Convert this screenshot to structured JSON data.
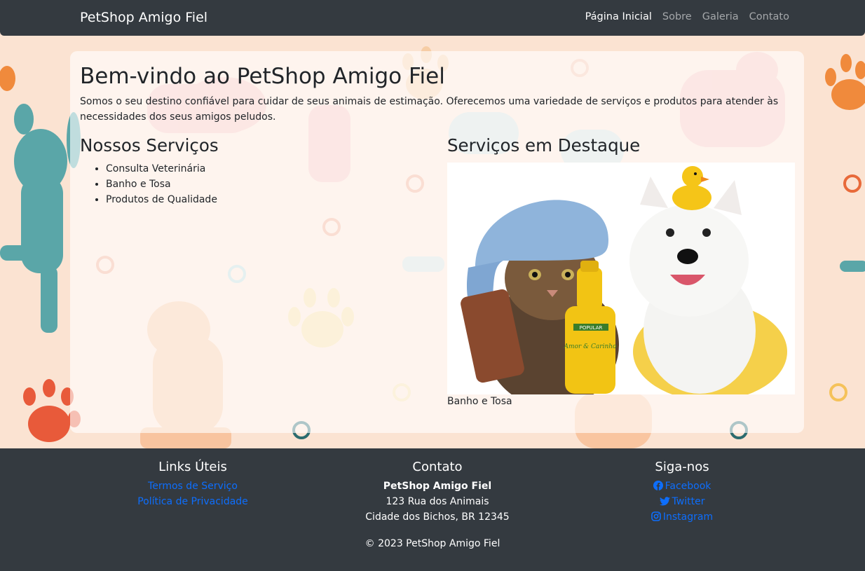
{
  "navbar": {
    "brand": "PetShop Amigo Fiel",
    "links": [
      {
        "label": "Página Inicial",
        "active": true
      },
      {
        "label": "Sobre",
        "active": false
      },
      {
        "label": "Galeria",
        "active": false
      },
      {
        "label": "Contato",
        "active": false
      }
    ]
  },
  "main": {
    "title": "Bem-vindo ao PetShop Amigo Fiel",
    "intro": "Somos o seu destino confiável para cuidar de seus animais de estimação. Oferecemos uma variedade de serviços e produtos para atender às necessidades dos seus amigos peludos.",
    "services_heading": "Nossos Serviços",
    "services": [
      "Consulta Veterinária",
      "Banho e Tosa",
      "Produtos de Qualidade"
    ],
    "featured_heading": "Serviços em Destaque",
    "featured_caption": "Banho e Tosa",
    "bottle_brand": "POPULAR",
    "bottle_label": "Amor & Carinho"
  },
  "footer": {
    "links_heading": "Links Úteis",
    "links": [
      "Termos de Serviço",
      "Política de Privacidade"
    ],
    "contact_heading": "Contato",
    "contact_name": "PetShop Amigo Fiel",
    "contact_street": "123 Rua dos Animais",
    "contact_city": "Cidade dos Bichos, BR 12345",
    "social_heading": "Siga-nos",
    "social": [
      {
        "label": "Facebook",
        "icon": "facebook-icon"
      },
      {
        "label": "Twitter",
        "icon": "twitter-icon"
      },
      {
        "label": "Instagram",
        "icon": "instagram-icon"
      }
    ],
    "copyright": "© 2023 PetShop Amigo Fiel"
  },
  "colors": {
    "navbar_bg": "#343a40",
    "footer_bg": "#343a40",
    "link": "#0d6efd",
    "page_bg": "#fbe6d6"
  }
}
